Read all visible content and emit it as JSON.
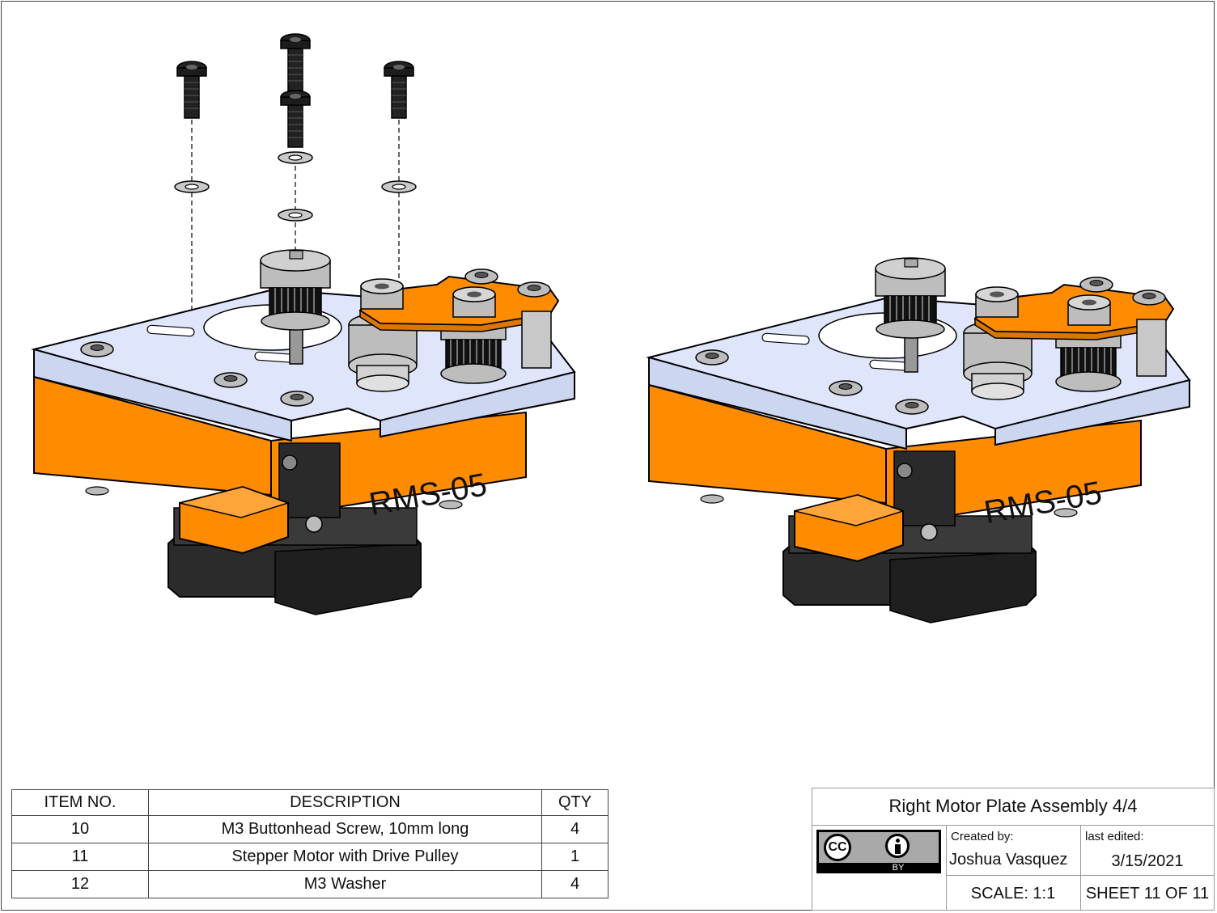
{
  "drawing": {
    "part_label_left": "RMS-05",
    "part_label_right": "RMS-05",
    "colors": {
      "plate": "#dfe6fb",
      "orange": "#ff8c00",
      "motor": "#2b2b2b",
      "steel": "#bdbdbd"
    }
  },
  "bom": {
    "headers": {
      "item": "ITEM NO.",
      "description": "DESCRIPTION",
      "qty": "QTY"
    },
    "rows": [
      {
        "item": "10",
        "description": "M3 Buttonhead Screw, 10mm long",
        "qty": "4"
      },
      {
        "item": "11",
        "description": "Stepper Motor with Drive Pulley",
        "qty": "1"
      },
      {
        "item": "12",
        "description": "M3 Washer",
        "qty": "4"
      }
    ]
  },
  "title_block": {
    "title": "Right Motor Plate Assembly 4/4",
    "created_by_label": "Created by:",
    "author": "Joshua Vasquez",
    "last_edited_label": "last edited:",
    "date": "3/15/2021",
    "scale": "SCALE: 1:1",
    "sheet": "SHEET 11 OF 11",
    "license_cc": "CC",
    "license_by": "BY",
    "license_icon": "creative-commons-by-icon"
  }
}
